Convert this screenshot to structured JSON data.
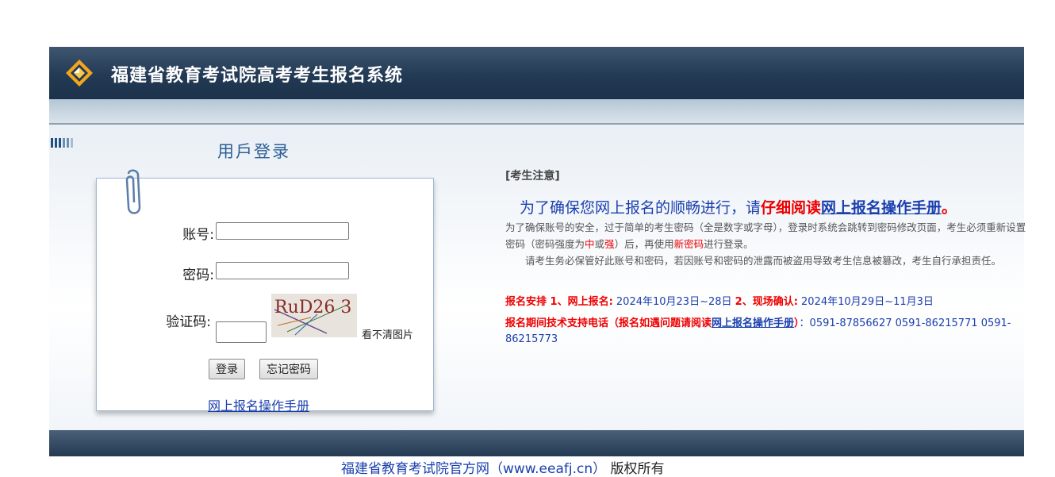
{
  "header": {
    "site_title": "福建省教育考试院高考考生报名系统",
    "logo_icon": "eeafj-diamond-logo-icon"
  },
  "login": {
    "title": "用戶登录",
    "account_label": "账号:",
    "password_label": "密码:",
    "captcha_label": "验证码:",
    "captcha_text": "RuD26 3",
    "cant_see_link": "看不清图片",
    "login_button": "登录",
    "forgot_button": "忘记密码",
    "manual_link": "网上报名操作手册",
    "account_value": "",
    "password_value": "",
    "captcha_value": ""
  },
  "notice": {
    "heading": "[考生注意]",
    "big_prefix": "为了确保您网上报名的顺畅进行，请",
    "big_red": "仔细阅读",
    "big_link": "网上报名操作手册",
    "big_suffix": "。",
    "para1_a": "为了确保账号的安全，过于简单的考生密码（全是数字或字母），登录时系统会跳转到密码修改页面，考生必须重新设置密码（密码强度为",
    "para1_zhong": "中",
    "para1_or": "或",
    "para1_qiang": "强",
    "para1_b": "）后，再使用",
    "para1_new": "新密码",
    "para1_c": "进行登录。",
    "para2": "请考生务必保管好此账号和密码，若因账号和密码的泄露而被盗用导致考生信息被篡改，考生自行承担责任。",
    "sched_label": "报名安排 1、网上报名:",
    "sched_online": " 2024年10月23日~28日 ",
    "sched_label2": "2、现场确认:",
    "sched_onsite": " 2024年10月29日~11月3日",
    "support_label": "报名期间技术支持电话（报名如遇问题请阅读",
    "support_link": "网上报名操作手册",
    "support_close": "）",
    "support_phones": "：0591-87856627  0591-86215771  0591-86215773"
  },
  "footer": {
    "site_link": "福建省教育考试院官方网（www.eeafj.cn）",
    "rights": "  版权所有"
  },
  "colors": {
    "header_bg": "#233a54",
    "link_blue": "#1a3fae",
    "alert_red": "#ee0000"
  }
}
